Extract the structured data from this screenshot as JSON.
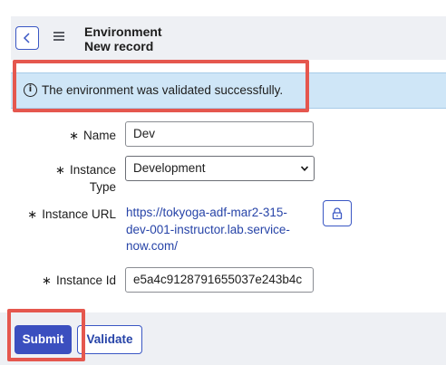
{
  "header": {
    "title_line1": "Environment",
    "title_line2": "New record",
    "back_icon": "chevron-left-icon",
    "menu_icon": "hamburger-menu-icon"
  },
  "info_banner": {
    "icon": "info-icon",
    "icon_glyph": "i",
    "message": "The environment was validated successfully."
  },
  "form": {
    "required_marker": "∗",
    "name": {
      "label": "Name",
      "value": "Dev"
    },
    "instance_type": {
      "label_line1": "Instance",
      "label_line2": "Type",
      "selected": "Development"
    },
    "instance_url": {
      "label": "Instance URL",
      "line1": "https://tokyoga-adf-mar2-315-",
      "line2": "dev-001-instructor.lab.service-",
      "line3": "now.com/",
      "lock_icon": "lock-icon"
    },
    "instance_id": {
      "label": "Instance Id",
      "value": "e5a4c9128791655037e243b4c"
    }
  },
  "actions": {
    "submit_label": "Submit",
    "validate_label": "Validate"
  },
  "colors": {
    "accent": "#3b4fbf",
    "info_bg": "#cfe6f7",
    "highlight": "#e5574e",
    "link": "#2744a8"
  }
}
